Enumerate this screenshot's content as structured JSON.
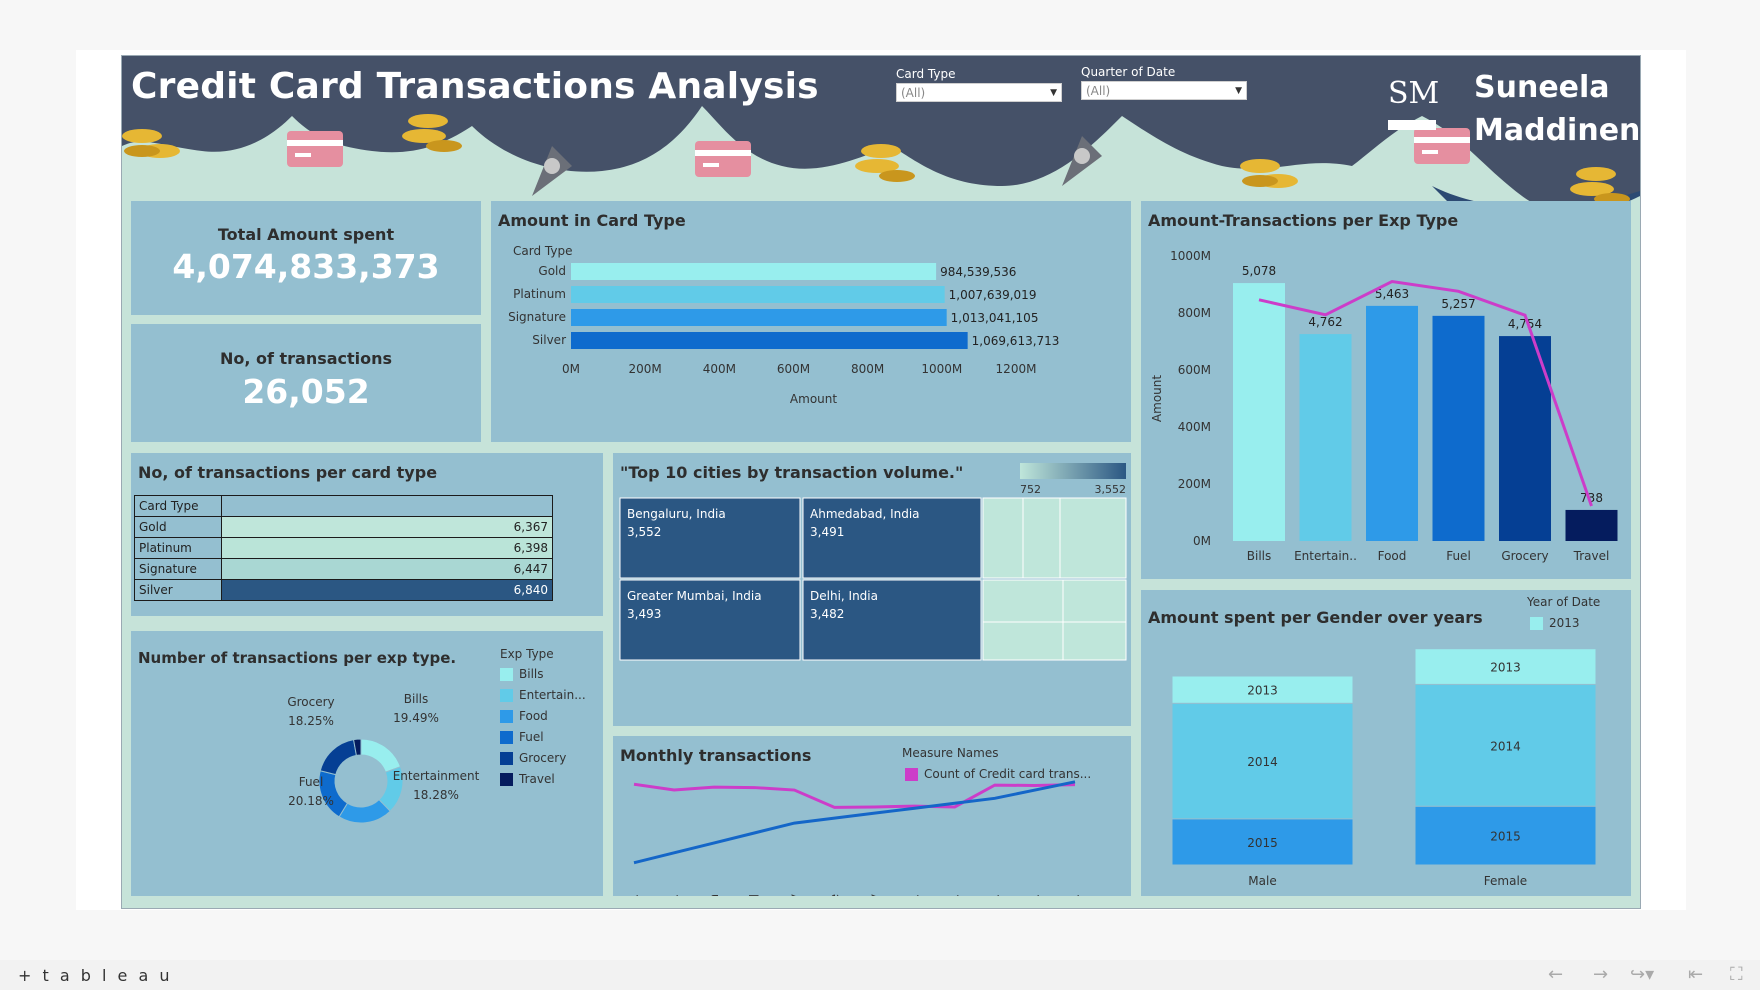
{
  "header": {
    "title": "Credit Card Transactions Analysis",
    "author": [
      "Suneela",
      "Maddineni"
    ],
    "logo_text": "SM",
    "filters": [
      {
        "label": "Card Type",
        "value": "(All)"
      },
      {
        "label": "Quarter of Date",
        "value": "(All)"
      }
    ]
  },
  "kpis": {
    "total_amount_label": "Total Amount spent",
    "total_amount_value": "4,074,833,373",
    "transactions_label": "No, of transactions",
    "transactions_value": "26,052"
  },
  "colors": {
    "header_bg": "#455168",
    "panel_bg": "#94bfd0",
    "dash_bg": "#c6e3d9",
    "bills": "#98eeee",
    "entertainment": "#61cbe8",
    "food": "#2e9ae8",
    "fuel": "#0e6bcd",
    "grocery": "#053f94",
    "travel": "#051c5e",
    "line_magenta": "#cc3dc9",
    "line_blue": "#1466c8",
    "treemap_dark": "#2b5783",
    "treemap_light": "#bfe6da"
  },
  "chart_data": [
    {
      "id": "amount_card_type",
      "type": "bar",
      "orientation": "horizontal",
      "title": "Amount in Card Type",
      "row_header": "Card Type",
      "xlabel": "Amount",
      "categories": [
        "Gold",
        "Platinum",
        "Signature",
        "Silver"
      ],
      "values": [
        984539536,
        1007639019,
        1013041105,
        1069613713
      ],
      "value_labels": [
        "984,539,536",
        "1,007,639,019",
        "1,013,041,105",
        "1,069,613,713"
      ],
      "xlim": [
        0,
        1200000000
      ],
      "xticks": [
        "0M",
        "200M",
        "400M",
        "600M",
        "800M",
        "1000M",
        "1200M"
      ],
      "colors": [
        "#98eeee",
        "#61cbe8",
        "#2e9ae8",
        "#0e6bcd"
      ]
    },
    {
      "id": "amount_transactions_exp",
      "type": "bar",
      "title": "Amount-Transactions per Exp Type",
      "ylabel": "Amount",
      "categories": [
        "Bills",
        "Entertain..",
        "Food",
        "Fuel",
        "Grocery",
        "Travel"
      ],
      "values": [
        905000000,
        726000000,
        825000000,
        790000000,
        719000000,
        109000000
      ],
      "transaction_counts": [
        5078,
        4762,
        5463,
        5257,
        4754,
        738
      ],
      "count_labels": [
        "5,078",
        "4,762",
        "5,463",
        "5,257",
        "4,754",
        "738"
      ],
      "ylim": [
        0,
        1000000000
      ],
      "yticks": [
        "0M",
        "200M",
        "400M",
        "600M",
        "800M",
        "1000M"
      ],
      "colors": [
        "#98eeee",
        "#61cbe8",
        "#2e9ae8",
        "#0e6bcd",
        "#053f94",
        "#051c5e"
      ]
    },
    {
      "id": "transactions_per_card_type",
      "type": "table",
      "title": "No, of transactions per card type",
      "column_header": "Card Type",
      "rows": [
        {
          "label": "Gold",
          "value": "6,367"
        },
        {
          "label": "Platinum",
          "value": "6,398"
        },
        {
          "label": "Signature",
          "value": "6,447"
        },
        {
          "label": "Silver",
          "value": "6,840"
        }
      ]
    },
    {
      "id": "top_cities",
      "type": "treemap",
      "title": "\"Top 10 cities by transaction volume.\"",
      "legend_range": [
        "752",
        "3,552"
      ],
      "cells": [
        {
          "label": "Bengaluru, India",
          "value": "3,552"
        },
        {
          "label": "Ahmedabad, India",
          "value": "3,491"
        },
        {
          "label": "Greater Mumbai, India",
          "value": "3,493"
        },
        {
          "label": "Delhi, India",
          "value": "3,482"
        }
      ]
    },
    {
      "id": "exp_type_donut",
      "type": "pie",
      "title": "Number of transactions per exp type.",
      "legend_title": "Exp Type",
      "legend": [
        "Bills",
        "Entertain...",
        "Food",
        "Fuel",
        "Grocery",
        "Travel"
      ],
      "categories": [
        "Bills",
        "Entertainment",
        "Food",
        "Fuel",
        "Grocery",
        "Travel"
      ],
      "values": [
        19.49,
        18.28,
        20.97,
        20.18,
        18.25,
        2.83
      ],
      "labels": [
        {
          "name": "Bills",
          "pct": "19.49%"
        },
        {
          "name": "Entertainment",
          "pct": "18.28%"
        },
        {
          "name": "Fuel",
          "pct": "20.18%"
        },
        {
          "name": "Grocery",
          "pct": "18.25%"
        }
      ],
      "colors": [
        "#98eeee",
        "#61cbe8",
        "#2e9ae8",
        "#0e6bcd",
        "#053f94",
        "#051c5e"
      ]
    },
    {
      "id": "monthly_transactions",
      "type": "line",
      "title": "Monthly transactions",
      "legend_title": "Measure Names",
      "legend_label": "Count of Credit card trans...",
      "categories": [
        "Janu..",
        "Febr..",
        "March",
        "April",
        "May",
        "June",
        "July",
        "Augu..",
        "Sept..",
        "Octo..",
        "Nove..",
        "Dece.."
      ],
      "series": [
        {
          "name": "Count of Credit card trans...",
          "values": [
            2250,
            2180,
            2215,
            2210,
            2180,
            1970,
            1975,
            1985,
            1975,
            2240,
            2235,
            2245
          ]
        },
        {
          "name": "",
          "values": [
            1300,
            1420,
            1540,
            1660,
            1780,
            1840,
            1900,
            1960,
            2020,
            2080,
            2180,
            2280
          ]
        }
      ],
      "ylim": [
        1200,
        2350
      ]
    },
    {
      "id": "gender_years",
      "type": "bar",
      "stacked": true,
      "title": "Amount spent per Gender over years",
      "legend_title": "Year of Date",
      "legend": [
        "2013"
      ],
      "categories": [
        "Male",
        "Female"
      ],
      "series": [
        {
          "name": "2015",
          "values": [
            22,
            28
          ]
        },
        {
          "name": "2014",
          "values": [
            55,
            58
          ]
        },
        {
          "name": "2013",
          "values": [
            13,
            17
          ]
        }
      ],
      "ylim": [
        0,
        100
      ],
      "colors": [
        "#2e9ae8",
        "#61cbe8",
        "#98eeee"
      ]
    }
  ],
  "footer": {
    "brand": "+ t a b l e a u"
  }
}
